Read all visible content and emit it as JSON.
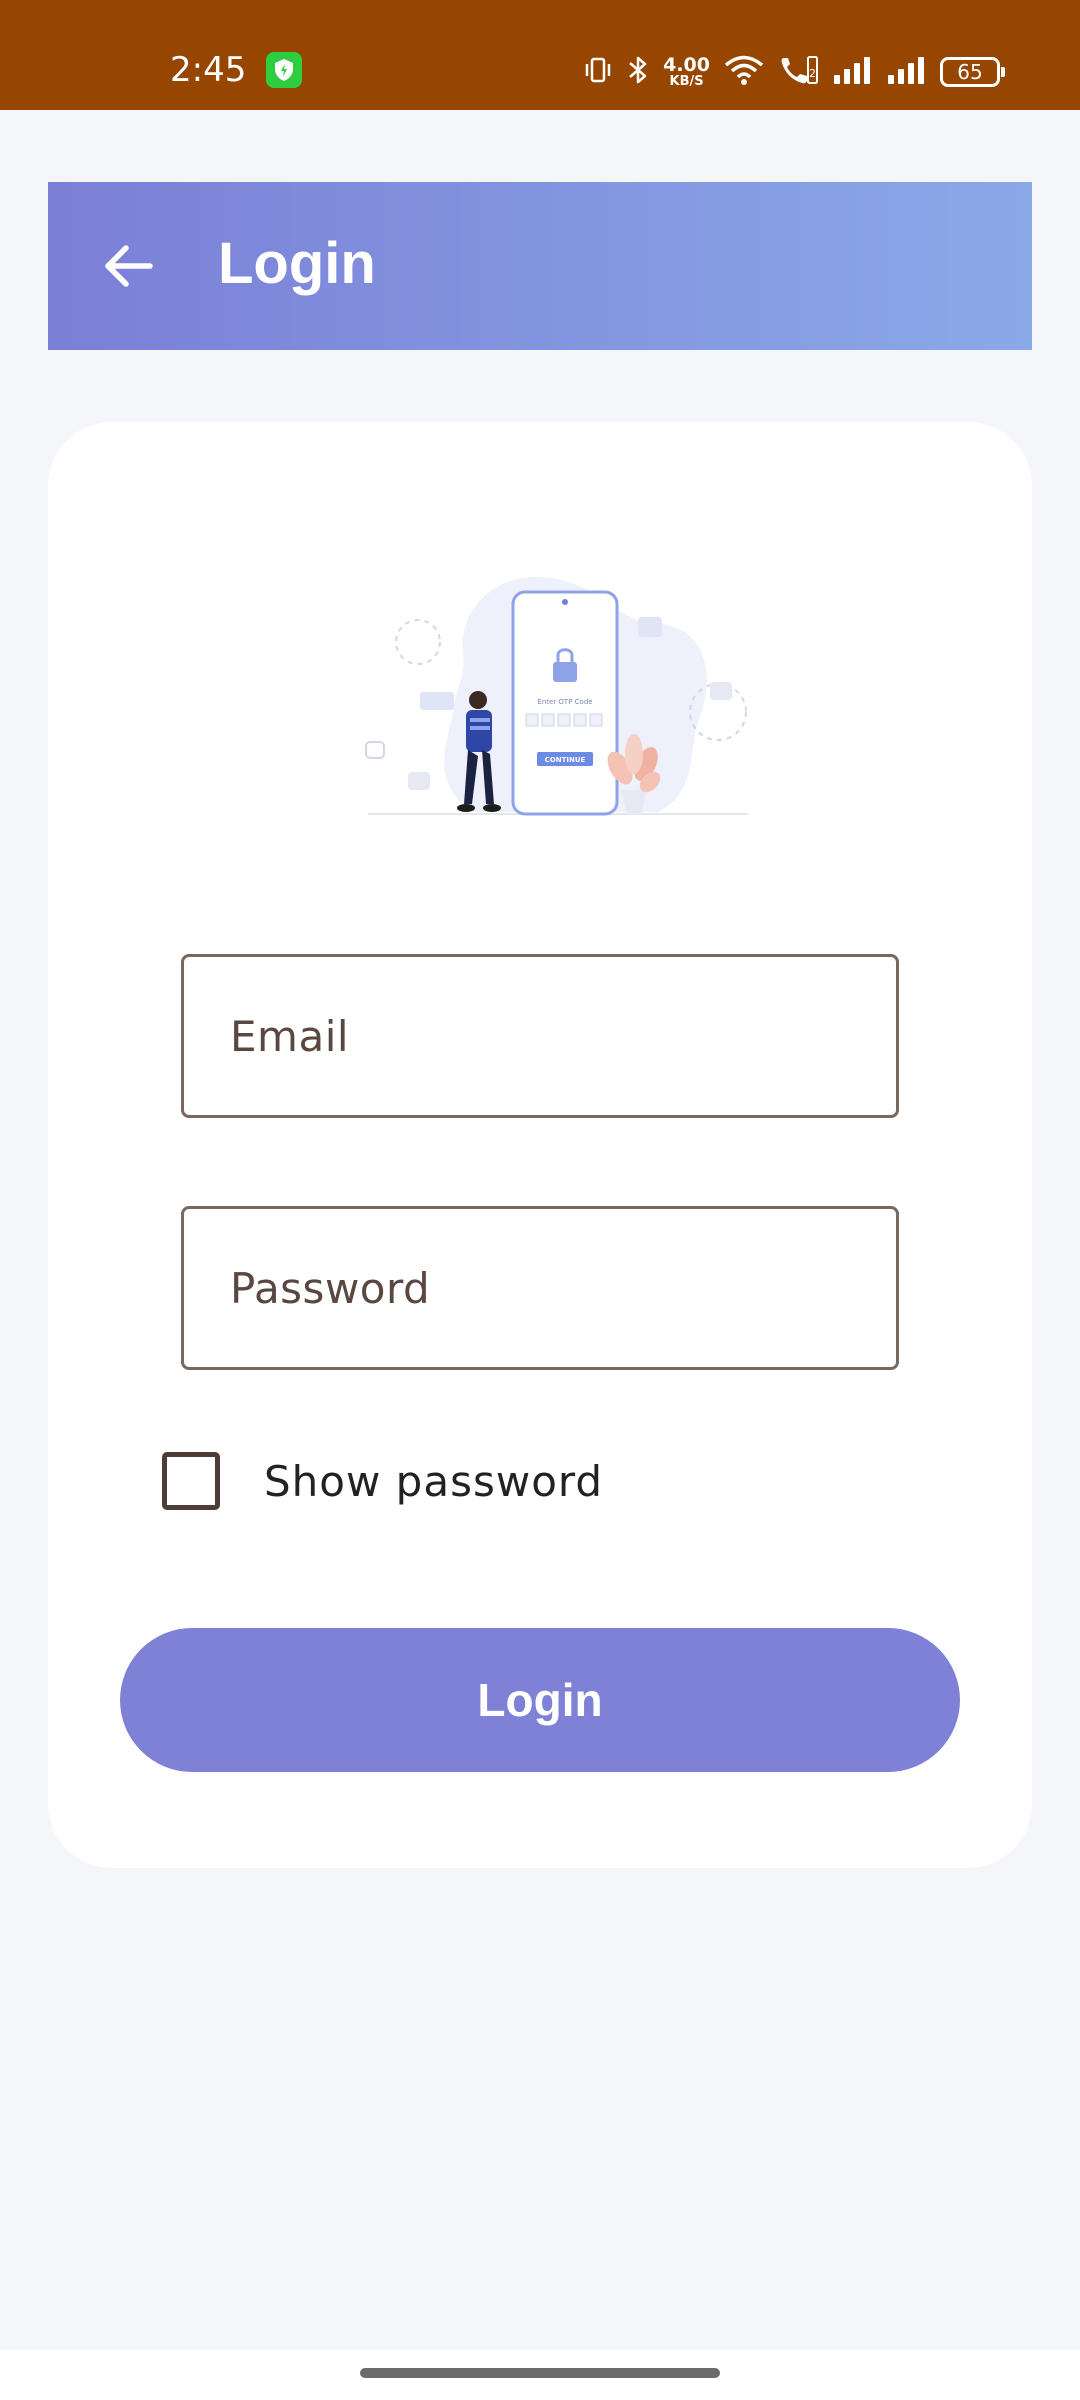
{
  "status_bar": {
    "time": "2:45",
    "net_speed_value": "4.00",
    "net_speed_unit": "KB/S",
    "battery": "65",
    "background_color": "#974600"
  },
  "app_bar": {
    "title": "Login",
    "back_icon": "arrow-left-icon",
    "gradient_start": "#7b7fd6",
    "gradient_end": "#8aa9e8"
  },
  "form": {
    "email_placeholder": "Email",
    "email_value": "",
    "password_placeholder": "Password",
    "password_value": "",
    "show_password_label": "Show password",
    "show_password_checked": false,
    "login_label": "Login",
    "button_color": "#7e81d6"
  },
  "illustration": {
    "otp_title": "Enter OTP Code",
    "continue_label": "CONTINUE"
  }
}
